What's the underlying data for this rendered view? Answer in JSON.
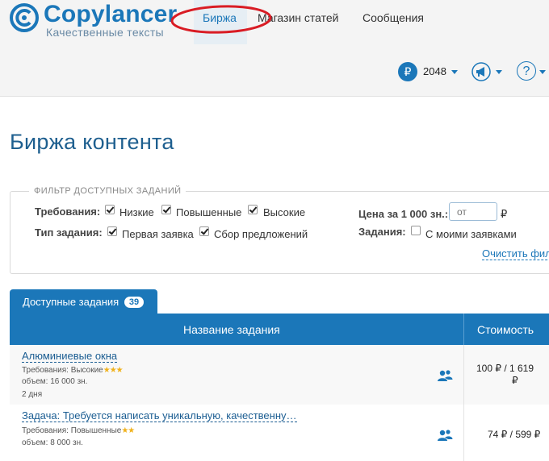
{
  "header": {
    "logo_name": "Copylancer",
    "logo_tagline": "Качественные тексты",
    "nav": [
      "Биржа",
      "Магазин статей",
      "Сообщения"
    ],
    "active_nav": "Биржа",
    "balance_currency_symbol": "₽",
    "balance": "2048",
    "help_symbol": "?",
    "accent_color": "#1b77b9",
    "highlight_ellipse_color": "#d91c24"
  },
  "page_title": "Биржа контента",
  "filter": {
    "legend": "ФИЛЬТР ДОСТУПНЫХ ЗАДАНИЙ",
    "requirements_label": "Требования:",
    "requirements": [
      {
        "label": "Низкие",
        "checked": true
      },
      {
        "label": "Повышенные",
        "checked": true
      },
      {
        "label": "Высокие",
        "checked": true
      }
    ],
    "type_label": "Тип задания:",
    "types": [
      {
        "label": "Первая заявка",
        "checked": true
      },
      {
        "label": "Сбор предложений",
        "checked": true
      }
    ],
    "price_label": "Цена за 1 000 зн.:",
    "price_placeholder": "от",
    "price_currency": "₽",
    "tasks_label": "Задания:",
    "tasks_option": {
      "label": "С моими заявками",
      "checked": false
    },
    "clear_link": "Очистить фил"
  },
  "tabs": [
    {
      "label": "Доступные задания",
      "count": "39",
      "active": true
    }
  ],
  "table": {
    "columns": [
      "Название задания",
      "Стоимость"
    ],
    "rows": [
      {
        "title": "Алюминиевые окна",
        "requirements_text": "Требования: Высокие",
        "stars": "★★★",
        "volume": "объем: 16 000 зн.",
        "deadline": "2 дня",
        "price_line1": "100 ₽ / 1 619",
        "price_line2": "₽",
        "icon": "users-icon"
      },
      {
        "title": "Задача: Требуется написать уникальную, качественну…",
        "requirements_text": "Требования: Повышенные",
        "stars": "★★",
        "volume": "объем: 8 000 зн.",
        "price_line1": "74 ₽ / 599 ₽",
        "icon": "users-icon"
      }
    ]
  }
}
